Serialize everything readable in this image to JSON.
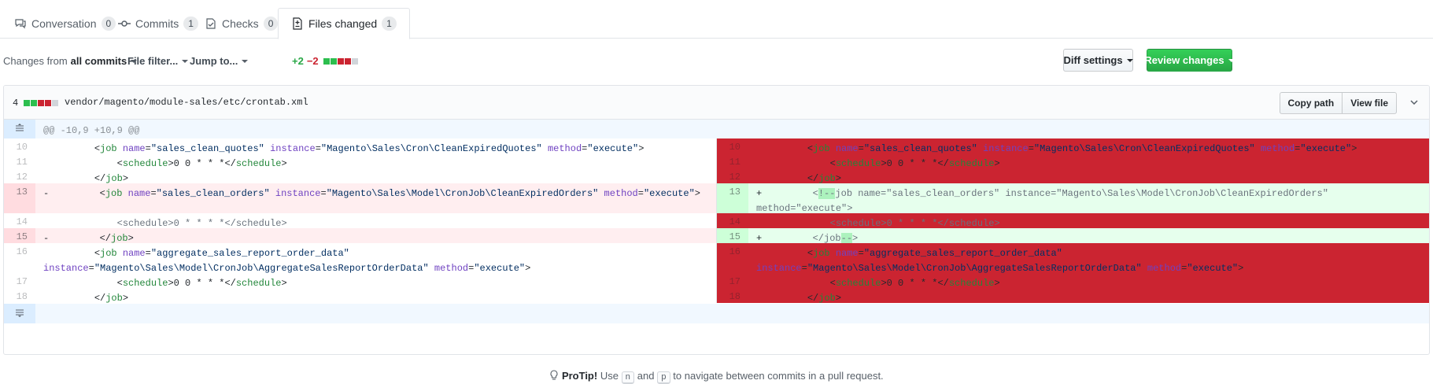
{
  "tabs": [
    {
      "label": "Conversation",
      "count": "0",
      "icon": "comment-icon"
    },
    {
      "label": "Commits",
      "count": "1",
      "icon": "commit-icon"
    },
    {
      "label": "Checks",
      "count": "0",
      "icon": "checklist-icon"
    },
    {
      "label": "Files changed",
      "count": "1",
      "icon": "file-diff-icon"
    }
  ],
  "toolbar": {
    "changes_from_prefix": "Changes from",
    "changes_from_value": "all commits",
    "file_filter": "File filter...",
    "jump_to": "Jump to...",
    "additions": "+2",
    "deletions": "−2",
    "diff_settings": "Diff settings",
    "review_changes": "Review changes"
  },
  "file": {
    "change_count": "4",
    "path": "vendor/magento/module-sales/etc/crontab.xml",
    "copy_path": "Copy path",
    "view_file": "View file"
  },
  "diff": {
    "hunk_header": "@@ -10,9 +10,9 @@",
    "left": {
      "l10": "10",
      "l11": "11",
      "l12": "12",
      "l13": "13",
      "l14": "14",
      "l15": "15",
      "l16": "16",
      "l17": "17",
      "l18": "18"
    },
    "right": {
      "l10": "10",
      "l11": "11",
      "l12": "12",
      "l13": "13",
      "l14": "14",
      "l15": "15",
      "l16": "16",
      "l17": "17",
      "l18": "18"
    }
  },
  "protip": {
    "lead": "ProTip!",
    "text1": " Use ",
    "key1": "n",
    "text2": " and ",
    "key2": "p",
    "text3": " to navigate between commits in a pull request."
  },
  "colors": {
    "addition": "#28a745",
    "deletion": "#cb2431",
    "primary_button": "#2ea44f"
  }
}
